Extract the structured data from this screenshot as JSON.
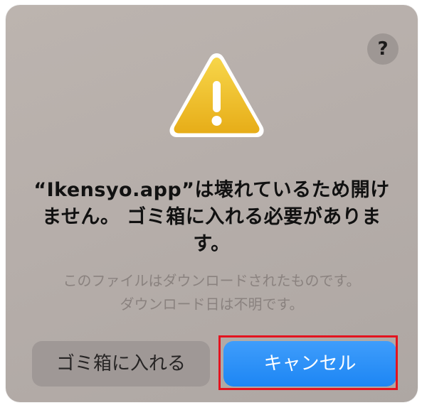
{
  "dialog": {
    "help_label": "?",
    "icon": "warning-triangle-icon",
    "title": "“Ikensyo.app”は壊れているため開けません。 ゴミ箱に入れる必要があります。",
    "message": "このファイルはダウンロードされたものです。\nダウンロード日は不明です。",
    "buttons": {
      "trash_label": "ゴミ箱に入れる",
      "cancel_label": "キャンセル"
    }
  },
  "colors": {
    "dialog_bg": "#b7b0ac",
    "accent": "#1d86f4",
    "highlight": "#e3141f",
    "warning_yellow": "#f2c230"
  }
}
